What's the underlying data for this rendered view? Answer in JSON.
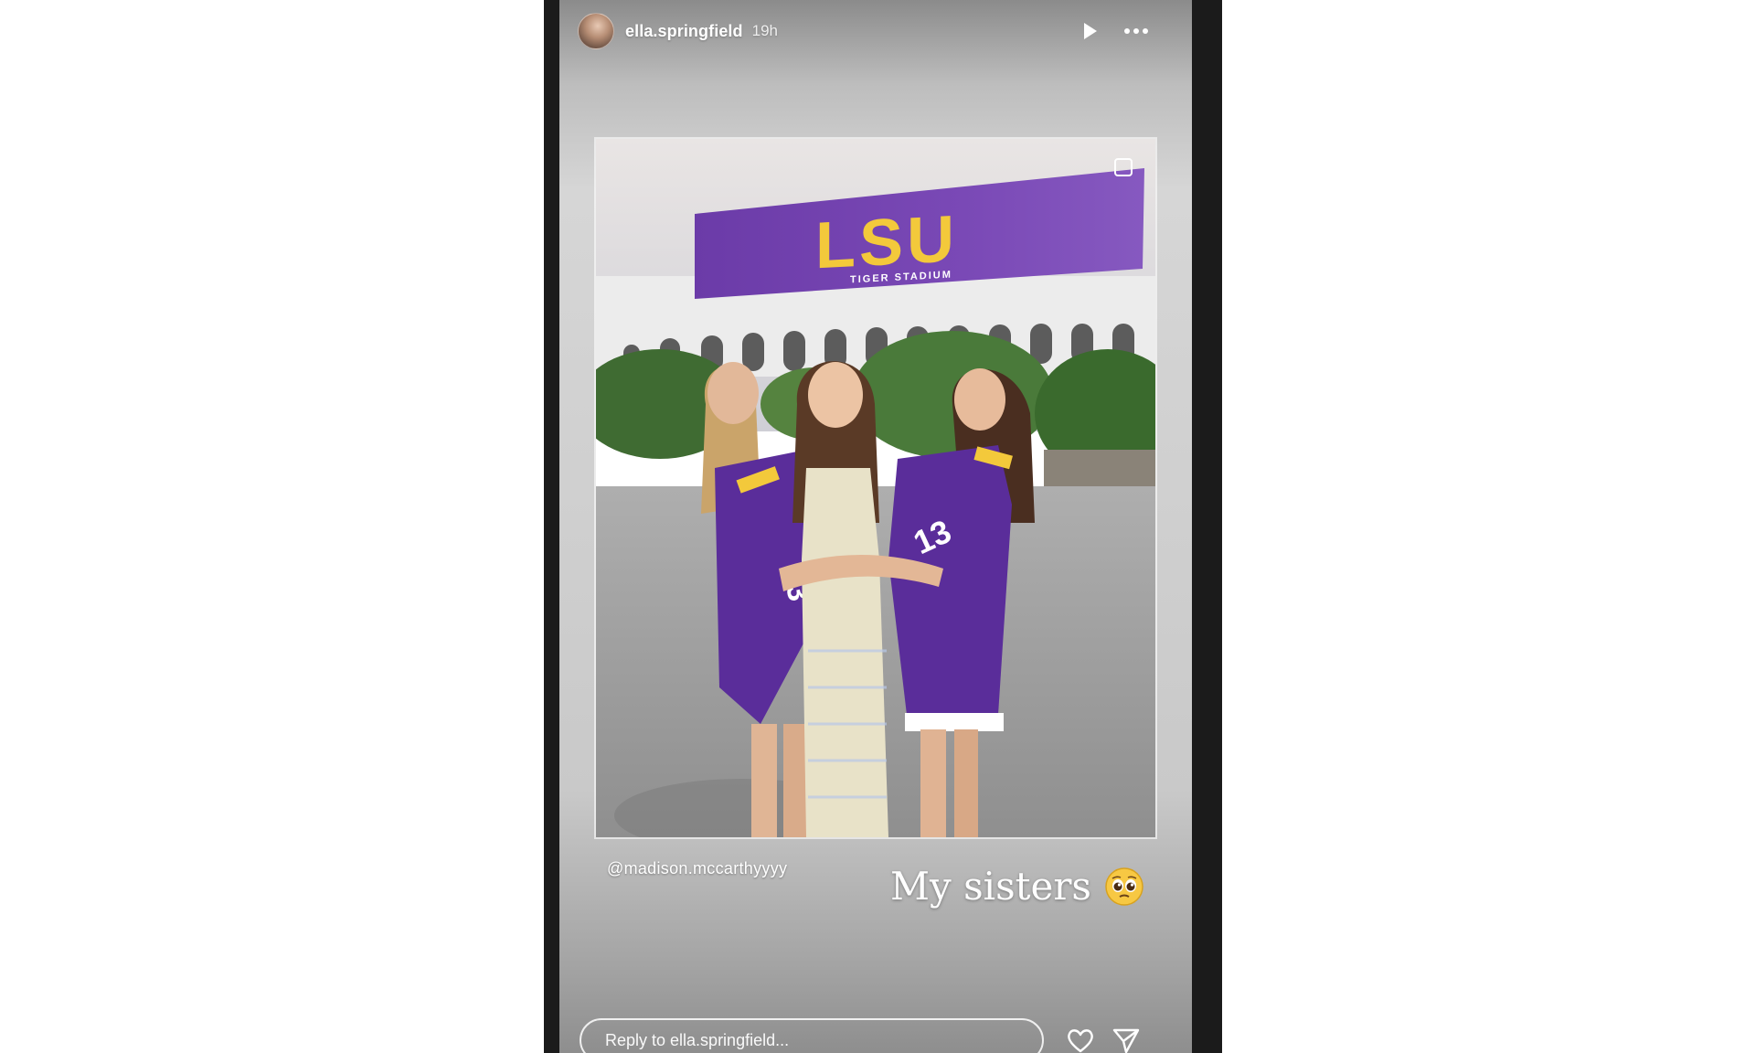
{
  "story": {
    "username": "ella.springfield",
    "timestamp": "19h",
    "mention": "@madison.mccarthyyyy",
    "caption": "My sisters",
    "emoji_icon": "pleading-face-emoji",
    "reply_placeholder": "Reply to ella.springfield..."
  },
  "photo": {
    "banner_text": "LSU",
    "banner_subtext": "TIGER STADIUM",
    "jersey_number_left": "13",
    "jersey_number_right": "13"
  },
  "icons": {
    "play": "play-icon",
    "more": "more-icon",
    "heart": "heart-icon",
    "send": "send-icon"
  },
  "colors": {
    "lsu_purple": "#6a3aa8",
    "lsu_gold": "#f3c93b",
    "text_white": "#ffffff"
  }
}
